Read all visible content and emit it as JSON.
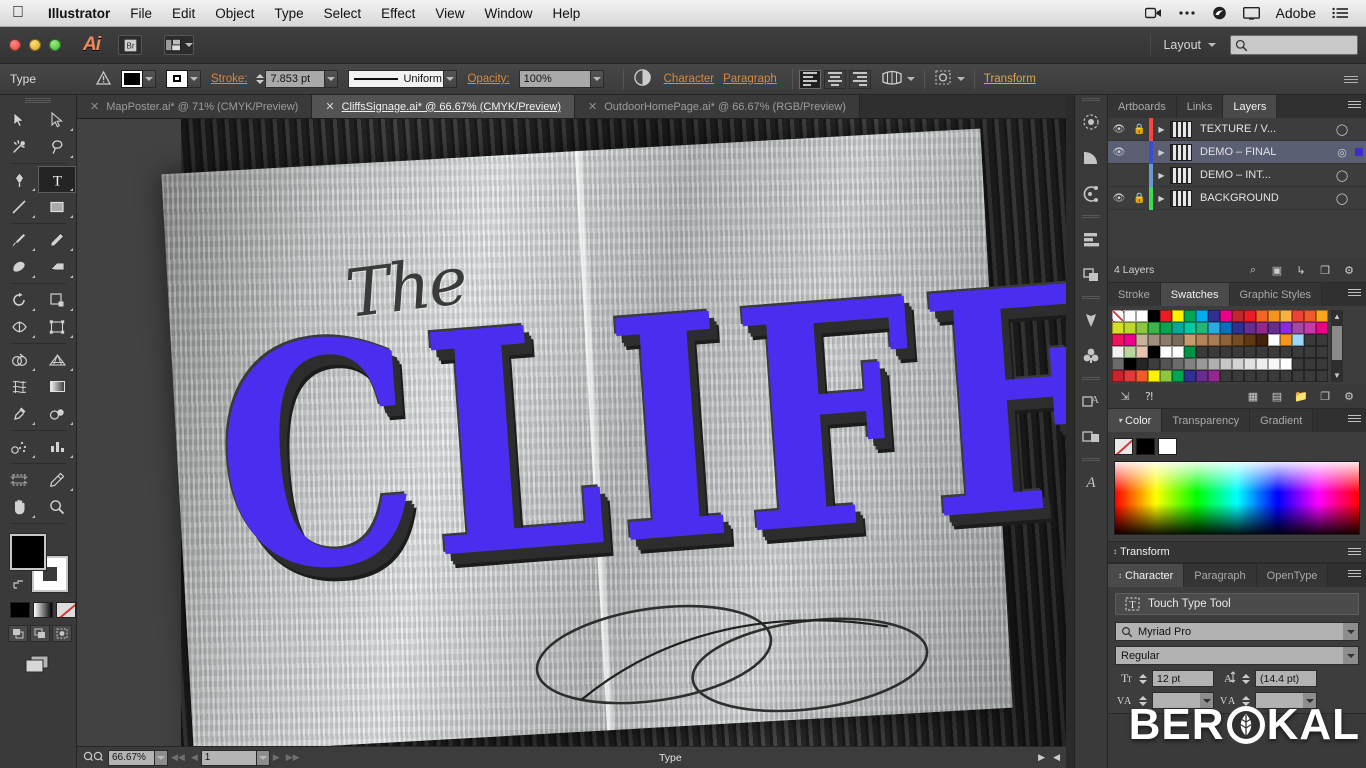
{
  "macmenu": {
    "apple_icon": "apple-logo",
    "items": [
      "Illustrator",
      "File",
      "Edit",
      "Object",
      "Type",
      "Select",
      "Effect",
      "View",
      "Window",
      "Help"
    ],
    "right_items": [
      {
        "name": "screen-record-icon",
        "glyph": "⬛"
      },
      {
        "name": "ellipsis-icon",
        "glyph": "•••"
      },
      {
        "name": "creative-cloud-icon",
        "glyph": "◎"
      },
      {
        "name": "display-icon",
        "glyph": "▭"
      },
      {
        "name": "adobe-label",
        "glyph": "Adobe"
      },
      {
        "name": "list-menu-icon",
        "glyph": "≡"
      }
    ]
  },
  "appbar": {
    "app_logo": "Ai",
    "bridge_label": "Br",
    "arrange_label": "arrange-documents",
    "workspace": "Layout",
    "search_placeholder": ""
  },
  "controlbar": {
    "selection_label": "Type",
    "warning_icon": "warning-icon",
    "fill_color": "#000000",
    "stroke_color": "#ffffff",
    "stroke_label": "Stroke:",
    "stroke_weight": "7.853 pt",
    "stroke_profile": "Uniform",
    "opacity_label": "Opacity:",
    "opacity_value": "100%",
    "character_link": "Character",
    "paragraph_link": "Paragraph",
    "transform_link": "Transform",
    "align_buttons": [
      "align-left",
      "align-center",
      "align-right"
    ],
    "envelope_icon": "envelope-distort-icon",
    "recolor_icon": "recolor-artwork-icon"
  },
  "tabs": [
    {
      "label": "MapPoster.ai* @ 71% (CMYK/Preview)",
      "active": false
    },
    {
      "label": "CliffsSignage.ai* @ 66.67% (CMYK/Preview)",
      "active": true
    },
    {
      "label": "OutdoorHomePage.ai* @ 66.67% (RGB/Preview)",
      "active": false
    }
  ],
  "toolbar": {
    "tools": [
      {
        "name": "selection-tool",
        "glyph": "➤",
        "active": false
      },
      {
        "name": "direct-selection-tool",
        "glyph": "➤",
        "active": false
      },
      {
        "name": "magic-wand-tool",
        "glyph": "✦",
        "active": false
      },
      {
        "name": "lasso-tool",
        "glyph": "☂",
        "active": false
      },
      {
        "name": "pen-tool",
        "glyph": "✒",
        "active": false
      },
      {
        "name": "type-tool",
        "glyph": "T",
        "active": true
      },
      {
        "name": "line-segment-tool",
        "glyph": "╱",
        "active": false
      },
      {
        "name": "rectangle-tool",
        "glyph": "□",
        "active": false
      },
      {
        "name": "paintbrush-tool",
        "glyph": "✎",
        "active": false
      },
      {
        "name": "pencil-tool",
        "glyph": "✏",
        "active": false
      },
      {
        "name": "blob-brush-tool",
        "glyph": "❀",
        "active": false
      },
      {
        "name": "eraser-tool",
        "glyph": "▱",
        "active": false
      },
      {
        "name": "rotate-tool",
        "glyph": "↻",
        "active": false
      },
      {
        "name": "scale-tool",
        "glyph": "◱",
        "active": false
      },
      {
        "name": "width-tool",
        "glyph": "⌘",
        "active": false
      },
      {
        "name": "free-transform-tool",
        "glyph": "⧉",
        "active": false
      },
      {
        "name": "shape-builder-tool",
        "glyph": "◔",
        "active": false
      },
      {
        "name": "perspective-grid-tool",
        "glyph": "◿",
        "active": false
      },
      {
        "name": "mesh-tool",
        "glyph": "⌗",
        "active": false
      },
      {
        "name": "gradient-tool",
        "glyph": "▤",
        "active": false
      },
      {
        "name": "eyedropper-tool",
        "glyph": "⚗",
        "active": false
      },
      {
        "name": "blend-tool",
        "glyph": "◑",
        "active": false
      },
      {
        "name": "symbol-sprayer-tool",
        "glyph": "⚇",
        "active": false
      },
      {
        "name": "column-graph-tool",
        "glyph": "█",
        "active": false
      },
      {
        "name": "artboard-tool",
        "glyph": "⬚",
        "active": false
      },
      {
        "name": "slice-tool",
        "glyph": "✄",
        "active": false
      },
      {
        "name": "hand-tool",
        "glyph": "✋",
        "active": false
      },
      {
        "name": "zoom-tool",
        "glyph": "⚲",
        "active": false
      }
    ],
    "fill_color": "#000000",
    "stroke_color": "#ffffff",
    "swap_icon": "swap-fill-stroke-icon",
    "color_modes": [
      "color-mode-black",
      "gradient-mode",
      "none-mode"
    ],
    "screen_modes": [
      "normal-screen-mode",
      "full-screen-menubar-mode",
      "full-screen-mode"
    ],
    "change_screen_icon": "change-screen-mode-icon"
  },
  "canvas": {
    "artwork_script_word": "The",
    "artwork_main_word": "CLIFFS",
    "artwork_text_color": "#4a2ef0",
    "artwork_shadow_color": "#2d2d2d"
  },
  "statusbar": {
    "zoom_level": "66.67%",
    "artboard_number": "1",
    "status_text": "Type",
    "nav_first": "◀◀",
    "nav_prev": "◀",
    "nav_next": "▶",
    "nav_last": "▶▶"
  },
  "iconrail": {
    "groups": [
      [
        {
          "name": "stroke-panel-icon",
          "glyph": "✳"
        },
        {
          "name": "brushes-panel-icon",
          "glyph": "◥"
        },
        {
          "name": "symbols-panel-icon",
          "glyph": "⚹"
        }
      ],
      [
        {
          "name": "align-panel-icon",
          "glyph": "☰"
        },
        {
          "name": "pathfinder-panel-icon",
          "glyph": "⧉"
        }
      ],
      [
        {
          "name": "image-trace-panel-icon",
          "glyph": "✿"
        },
        {
          "name": "brush-libraries-icon",
          "glyph": "♣"
        }
      ],
      [
        {
          "name": "appearance-panel-icon",
          "glyph": "Ⓐ"
        },
        {
          "name": "graphic-styles-panel-icon",
          "glyph": "◫"
        }
      ],
      [
        {
          "name": "glyphs-panel-icon",
          "glyph": "ᴀ"
        }
      ]
    ]
  },
  "layers_panel": {
    "tabs": [
      {
        "label": "Artboards",
        "active": false
      },
      {
        "label": "Links",
        "active": false
      },
      {
        "label": "Layers",
        "active": true
      }
    ],
    "rows": [
      {
        "name": "TEXTURE / V...",
        "visible": true,
        "locked": true,
        "color": "#ff4444",
        "selected": false,
        "has_selection_dot": false
      },
      {
        "name": "DEMO – FINAL",
        "visible": true,
        "locked": false,
        "color": "#3b4ecf",
        "selected": true,
        "has_selection_dot": true
      },
      {
        "name": "DEMO – INT...",
        "visible": false,
        "locked": false,
        "color": "#6a9ad0",
        "selected": false,
        "has_selection_dot": false
      },
      {
        "name": "BACKGROUND",
        "visible": true,
        "locked": true,
        "color": "#3ddc54",
        "selected": false,
        "has_selection_dot": false
      }
    ],
    "footer_count": "4 Layers",
    "footer_icons": [
      {
        "name": "locate-object-icon",
        "glyph": "⌕"
      },
      {
        "name": "make-clipping-mask-icon",
        "glyph": "◱"
      },
      {
        "name": "create-sublayer-icon",
        "glyph": "↳"
      },
      {
        "name": "create-new-layer-icon",
        "glyph": "❐"
      },
      {
        "name": "delete-layer-icon",
        "glyph": "Ὕ1"
      }
    ]
  },
  "swatches_panel": {
    "tabs": [
      {
        "label": "Stroke",
        "active": false
      },
      {
        "label": "Swatches",
        "active": true
      },
      {
        "label": "Graphic Styles",
        "active": false
      }
    ],
    "rows": [
      [
        "none",
        "#ffffff",
        "#ffffff",
        "#000000",
        "#ed1c24",
        "#fff200",
        "#00a651",
        "#00aeef",
        "#2e3192",
        "#ec008c",
        "#c1272d",
        "#ed1c24",
        "#f26522",
        "#f7941e",
        "#fbb040",
        "#ef4136",
        "#f15a29",
        "#faa61a"
      ],
      [
        "#d7df23",
        "#bed62f",
        "#8dc63f",
        "#39b54a",
        "#00a651",
        "#00a99d",
        "#00c8a0",
        "#22b573",
        "#29abe2",
        "#0071bc",
        "#2e3192",
        "#662d91",
        "#92278f",
        "#662d91",
        "#8a2be2",
        "#a349a4",
        "#c837ab",
        "#ec008c"
      ],
      [
        "#ed145b",
        "#ec008c",
        "#c7b299",
        "#9e8e7e",
        "#8c7b6b",
        "#7a6a5a",
        "#c69c6d",
        "#b5835a",
        "#a67c52",
        "#8c6239",
        "#754c24",
        "#603913",
        "#42210b",
        "#ffffff",
        "#f7941e",
        "#9ad9f5",
        "#3a3a3a",
        "#3a3a3a"
      ],
      [
        "#f2f2f2",
        "#b5d99c",
        "#e8c3b0",
        "#000000",
        "#ffffff",
        "#ffffff",
        "#009245",
        "#3a3a3a",
        "#3a3a3a",
        "#3a3a3a",
        "#3a3a3a",
        "#3a3a3a",
        "#3a3a3a",
        "#3a3a3a",
        "#3a3a3a",
        "#3a3a3a",
        "#3a3a3a",
        "#3a3a3a"
      ],
      [
        "#6b6b6b",
        "#000000",
        "#262626",
        "#3d3d3d",
        "#545454",
        "#6b6b6b",
        "#828282",
        "#999999",
        "#b0b0b0",
        "#c7c7c7",
        "#d4d4d4",
        "#e1e1e1",
        "#eeeeee",
        "#f7f7f7",
        "#ffffff",
        "#3a3a3a",
        "#3a3a3a",
        "#3a3a3a"
      ],
      [
        "#cc2229",
        "#e03a3e",
        "#f15a29",
        "#fff200",
        "#8dc63f",
        "#00a651",
        "#2e3192",
        "#662d91",
        "#92278f",
        "#3a3a3a",
        "#3a3a3a",
        "#3a3a3a",
        "#3a3a3a",
        "#3a3a3a",
        "#3a3a3a",
        "#3a3a3a",
        "#3a3a3a",
        "#3a3a3a"
      ]
    ],
    "footer_icons": [
      {
        "name": "swatch-libraries-icon",
        "glyph": "↘"
      },
      {
        "name": "color-group-icon",
        "glyph": "⁂"
      },
      {
        "name": "show-swatch-kinds-icon",
        "glyph": "▦"
      },
      {
        "name": "swatch-options-icon",
        "glyph": "▤"
      },
      {
        "name": "new-color-group-icon",
        "glyph": "▱"
      },
      {
        "name": "new-swatch-icon",
        "glyph": "❐"
      },
      {
        "name": "delete-swatch-icon",
        "glyph": "Ὕ1"
      }
    ]
  },
  "color_panel": {
    "tabs": [
      {
        "label": "Color",
        "active": true
      },
      {
        "label": "Transparency",
        "active": false
      },
      {
        "label": "Gradient",
        "active": false
      }
    ],
    "chips": [
      "none",
      "#000000",
      "#ffffff"
    ]
  },
  "transform_panel": {
    "title": "Transform"
  },
  "character_panel": {
    "tabs": [
      {
        "label": "Character",
        "active": true
      },
      {
        "label": "Paragraph",
        "active": false
      },
      {
        "label": "OpenType",
        "active": false
      }
    ],
    "touch_type_label": "Touch Type Tool",
    "font_family": "Myriad Pro",
    "font_style": "Regular",
    "font_size": "12 pt",
    "leading": "(14.4 pt)",
    "size_icon": "font-size-icon",
    "leading_icon": "leading-icon",
    "kerning_icon": "kerning-icon",
    "tracking_icon": "tracking-icon"
  },
  "watermark": {
    "text_left": "BER",
    "text_right": "KAL",
    "logo_name": "berakal-leaf-logo"
  }
}
